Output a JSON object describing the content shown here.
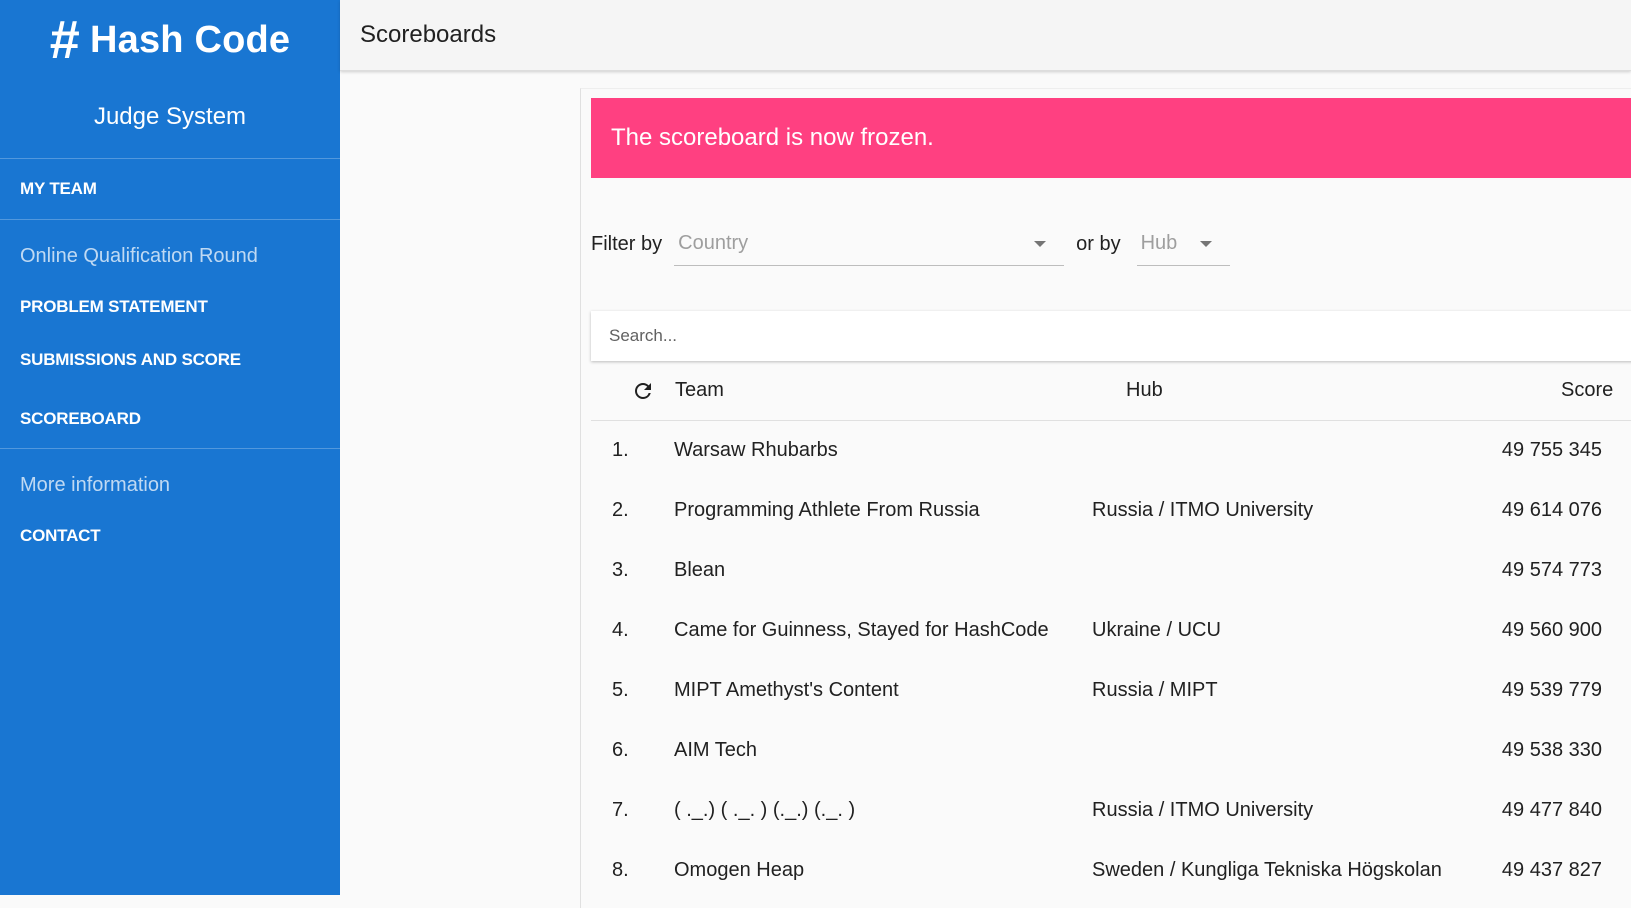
{
  "sidebar": {
    "logo_hash": "#",
    "logo_text": "Hash Code",
    "subtitle": "Judge System",
    "my_team": "MY TEAM",
    "section_round": "Online Qualification Round",
    "problem_statement": "PROBLEM STATEMENT",
    "submissions": "SUBMISSIONS AND SCORE",
    "scoreboard": "SCOREBOARD",
    "section_more": "More information",
    "contact": "CONTACT"
  },
  "header": {
    "title": "Scoreboards"
  },
  "banner": {
    "text": "The scoreboard is now frozen.",
    "color": "#ff4081"
  },
  "filters": {
    "filter_by_label": "Filter by",
    "country_placeholder": "Country",
    "or_by_label": "or by",
    "hub_placeholder": "Hub"
  },
  "search": {
    "placeholder": "Search..."
  },
  "table": {
    "columns": {
      "team": "Team",
      "hub": "Hub",
      "score": "Score"
    },
    "rows": [
      {
        "rank": "1.",
        "team": "Warsaw Rhubarbs",
        "hub": "",
        "score": "49 755 345"
      },
      {
        "rank": "2.",
        "team": "Programming Athlete From Russia",
        "hub": "Russia / ITMO University",
        "score": "49 614 076"
      },
      {
        "rank": "3.",
        "team": "Blean",
        "hub": "",
        "score": "49 574 773"
      },
      {
        "rank": "4.",
        "team": "Came for Guinness, Stayed for HashCode",
        "hub": "Ukraine / UCU",
        "score": "49 560 900"
      },
      {
        "rank": "5.",
        "team": "MIPT Amethyst's Content",
        "hub": "Russia / MIPT",
        "score": "49 539 779"
      },
      {
        "rank": "6.",
        "team": "AIM Tech",
        "hub": "",
        "score": "49 538 330"
      },
      {
        "rank": "7.",
        "team": "( ._.) ( ._. ) (._.) (._. )",
        "hub": "Russia / ITMO University",
        "score": "49 477 840"
      },
      {
        "rank": "8.",
        "team": "Omogen Heap",
        "hub": "Sweden / Kungliga Tekniska Högskolan",
        "score": "49 437 827"
      }
    ]
  },
  "colors": {
    "sidebar": "#1976d2",
    "accent": "#ff4081"
  },
  "icons": {
    "refresh": "refresh-icon",
    "dropdown": "arrow-drop-down-icon"
  }
}
